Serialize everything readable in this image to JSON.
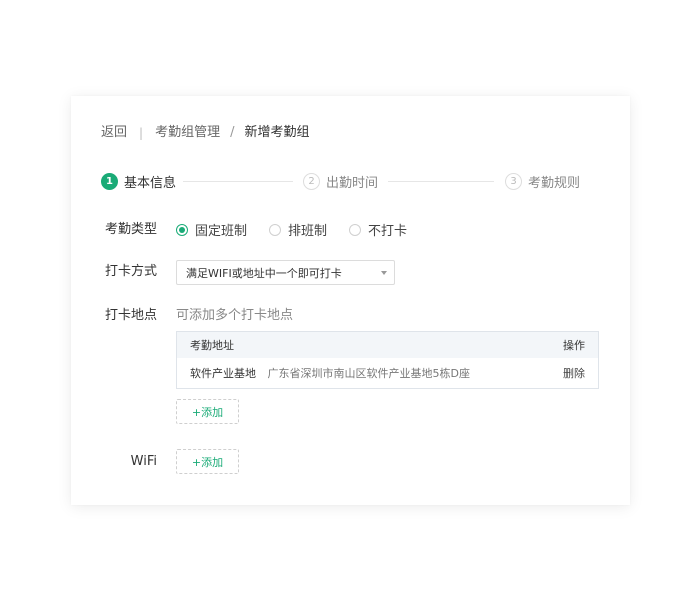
{
  "breadcrumb": {
    "back": "返回",
    "separator_bar": "|",
    "parent": "考勤组管理",
    "separator": "/",
    "current": "新增考勤组"
  },
  "steps": [
    {
      "number": "1",
      "label": "基本信息",
      "active": true
    },
    {
      "number": "2",
      "label": "出勤时间",
      "active": false
    },
    {
      "number": "3",
      "label": "考勤规则",
      "active": false
    }
  ],
  "form": {
    "attendance_type": {
      "label": "考勤类型",
      "options": [
        "固定班制",
        "排班制",
        "不打卡"
      ],
      "selected": "固定班制"
    },
    "clock_method": {
      "label": "打卡方式",
      "value": "满足WIFI或地址中一个即可打卡"
    },
    "clock_location": {
      "label": "打卡地点",
      "hint": "可添加多个打卡地点",
      "table": {
        "headers": [
          "考勤地址",
          "操作"
        ],
        "rows": [
          {
            "name": "软件产业基地",
            "address": "广东省深圳市南山区软件产业基地5栋D座",
            "action": "删除"
          }
        ]
      },
      "add_label": "+添加"
    },
    "wifi": {
      "label": "WiFi",
      "add_label": "+添加"
    }
  },
  "colors": {
    "accent": "#1aab77"
  }
}
